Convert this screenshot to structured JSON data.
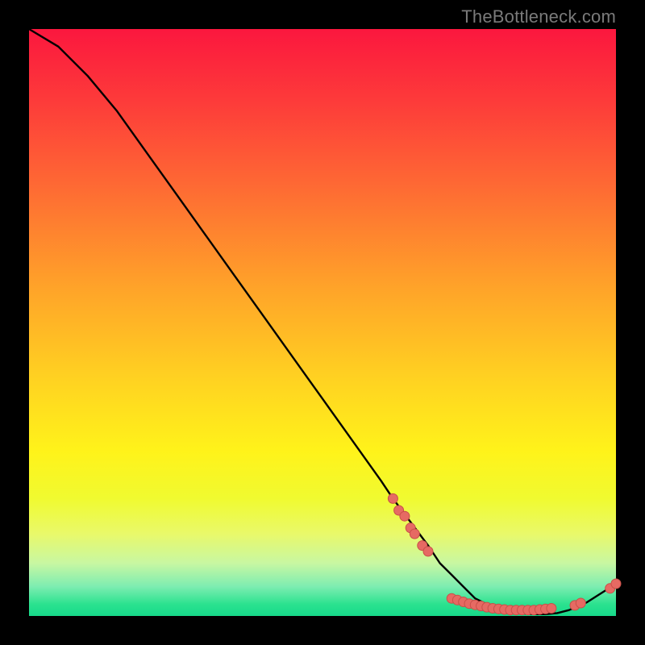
{
  "watermark": "TheBottleneck.com",
  "colors": {
    "curve": "#000000",
    "marker_fill": "#e66a63",
    "marker_stroke": "#c94f49",
    "gradient_top": "#fb173e",
    "gradient_bottom": "#17d98a"
  },
  "chart_data": {
    "type": "line",
    "title": "",
    "xlabel": "",
    "ylabel": "",
    "xlim": [
      0,
      100
    ],
    "ylim": [
      0,
      100
    ],
    "x": [
      0,
      5,
      10,
      15,
      20,
      25,
      30,
      35,
      40,
      45,
      50,
      55,
      60,
      62,
      65,
      68,
      70,
      72,
      74,
      76,
      78,
      80,
      82,
      84,
      86,
      88,
      90,
      92,
      95,
      98,
      100
    ],
    "values": [
      100,
      97,
      92,
      86,
      79,
      72,
      65,
      58,
      51,
      44,
      37,
      30,
      23,
      20,
      16,
      12,
      9,
      7,
      5,
      3,
      2,
      1.2,
      0.7,
      0.4,
      0.3,
      0.3,
      0.5,
      1.0,
      2.3,
      4.2,
      5.5
    ],
    "markers": [
      {
        "x": 62,
        "y": 20
      },
      {
        "x": 63,
        "y": 18
      },
      {
        "x": 64,
        "y": 17
      },
      {
        "x": 65,
        "y": 15
      },
      {
        "x": 65.7,
        "y": 14
      },
      {
        "x": 67,
        "y": 12
      },
      {
        "x": 68,
        "y": 11
      },
      {
        "x": 72,
        "y": 3.0
      },
      {
        "x": 73,
        "y": 2.7
      },
      {
        "x": 74,
        "y": 2.4
      },
      {
        "x": 75,
        "y": 2.1
      },
      {
        "x": 76,
        "y": 1.9
      },
      {
        "x": 77,
        "y": 1.7
      },
      {
        "x": 78,
        "y": 1.5
      },
      {
        "x": 79,
        "y": 1.3
      },
      {
        "x": 80,
        "y": 1.2
      },
      {
        "x": 81,
        "y": 1.1
      },
      {
        "x": 82,
        "y": 1.0
      },
      {
        "x": 83,
        "y": 1.0
      },
      {
        "x": 84,
        "y": 1.0
      },
      {
        "x": 85,
        "y": 1.0
      },
      {
        "x": 86,
        "y": 1.0
      },
      {
        "x": 87,
        "y": 1.1
      },
      {
        "x": 88,
        "y": 1.2
      },
      {
        "x": 89,
        "y": 1.3
      },
      {
        "x": 93,
        "y": 1.8
      },
      {
        "x": 94,
        "y": 2.2
      },
      {
        "x": 99,
        "y": 4.7
      },
      {
        "x": 100,
        "y": 5.5
      }
    ]
  }
}
